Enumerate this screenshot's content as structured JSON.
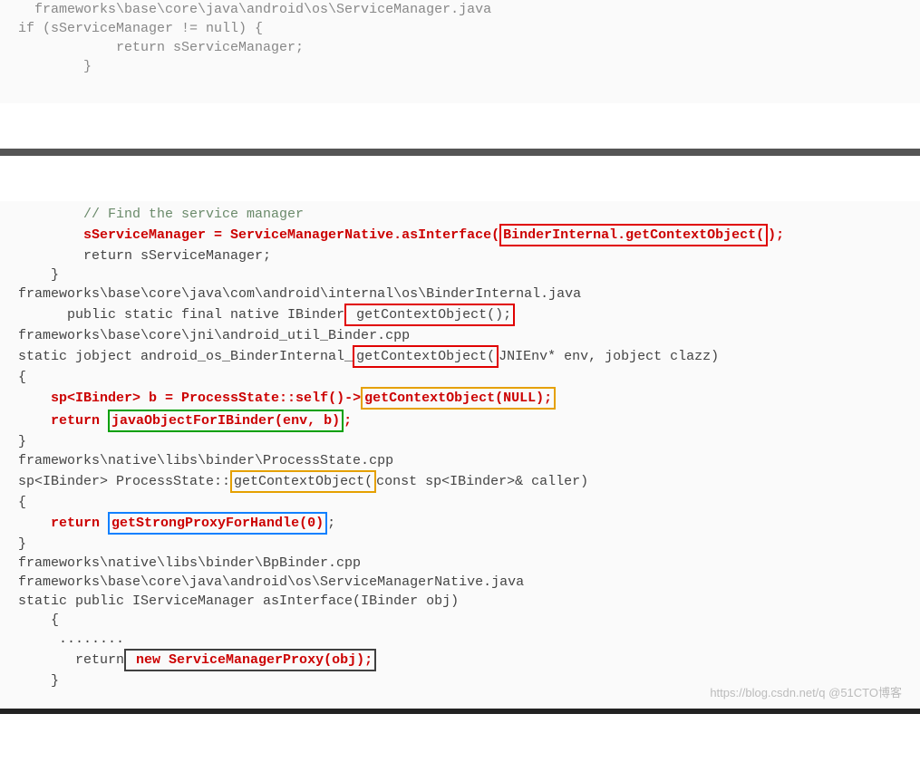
{
  "block1": {
    "l1": "  frameworks\\base\\core\\java\\android\\os\\ServiceManager.java",
    "l2": "if (sServiceManager != null) {",
    "l3": "            return sServiceManager;",
    "l4": "        }"
  },
  "block2": {
    "l1_indent": "        ",
    "l1_comment": "// Find the service manager",
    "l2_indent": "        ",
    "l2_a": "sServiceManager = ServiceManagerNative.asInterface(",
    "l2_box": "BinderInternal.getContextObject(",
    "l2_b": ");",
    "l3": "        return sServiceManager;",
    "l4": "    }",
    "l5": "",
    "l6": "frameworks\\base\\core\\java\\com\\android\\internal\\os\\BinderInternal.java",
    "l7_a": "      public static final native IBinder",
    "l7_box": " getContextObject();",
    "l8": "",
    "l9": "frameworks\\base\\core\\jni\\android_util_Binder.cpp",
    "l10_a": "static jobject android_os_BinderInternal_",
    "l10_box": "getContextObject(",
    "l10_b": "JNIEnv* env, jobject clazz)",
    "l11": "{",
    "l12_indent": "    ",
    "l12_a": "sp<IBinder> b = ProcessState::self()->",
    "l12_box": "getContextObject(NULL);",
    "l13_indent": "    ",
    "l13_a": "return ",
    "l13_box": "javaObjectForIBinder(env, b)",
    "l13_b": ";",
    "l14": "}",
    "l15": "",
    "l16": "frameworks\\native\\libs\\binder\\ProcessState.cpp",
    "l17_a": "sp<IBinder> ProcessState::",
    "l17_box": "getContextObject(",
    "l17_b": "const sp<IBinder>& caller)",
    "l18": "{",
    "l19_indent": "    ",
    "l19_a": "return ",
    "l19_box": "getStrongProxyForHandle(0)",
    "l19_b": ";",
    "l20": "}",
    "l21": "frameworks\\native\\libs\\binder\\BpBinder.cpp",
    "l22": "",
    "l23": "frameworks\\base\\core\\java\\android\\os\\ServiceManagerNative.java",
    "l24": "static public IServiceManager asInterface(IBinder obj)",
    "l25": "    {",
    "l26": "     ........",
    "l27_indent": "       ",
    "l27_a": "return",
    "l27_box": " new ServiceManagerProxy(obj);",
    "l28": "    }"
  },
  "watermark": "https://blog.csdn.net/q  @51CTO博客"
}
